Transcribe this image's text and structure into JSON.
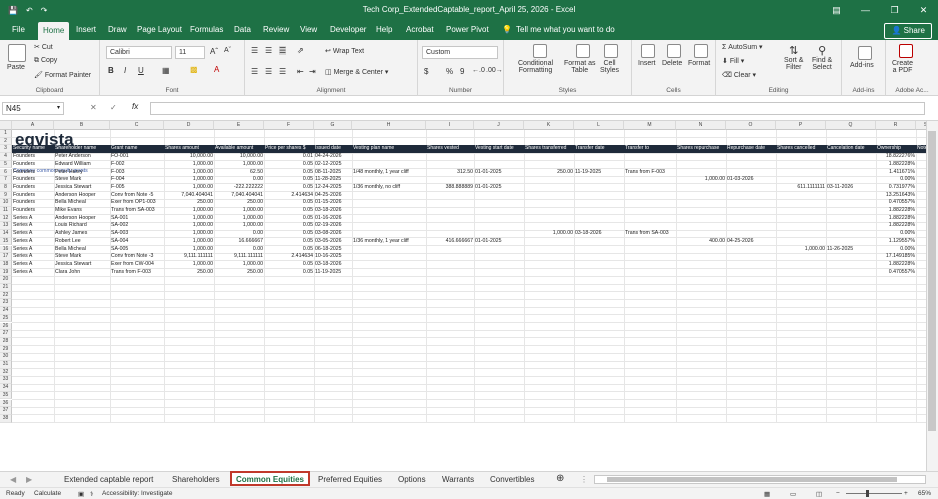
{
  "window": {
    "title": "Tech Corp_ExtendedCaptable_report_April 25, 2026  -  Excel",
    "minimize": "—",
    "restore": "❐",
    "close": "✕"
  },
  "ribbon_tabs": [
    "File",
    "Home",
    "Insert",
    "Draw",
    "Page Layout",
    "Formulas",
    "Data",
    "Review",
    "View",
    "Developer",
    "Help",
    "Acrobat",
    "Power Pivot"
  ],
  "active_tab": "Home",
  "tell_me": "Tell me what you want to do",
  "share": "Share",
  "ribbon": {
    "clipboard": {
      "paste": "Paste",
      "cut": "Cut",
      "copy": "Copy",
      "format_painter": "Format Painter",
      "label": "Clipboard"
    },
    "font": {
      "name": "Calibri",
      "size": "11",
      "bold": "B",
      "italic": "I",
      "underline": "U",
      "label": "Font"
    },
    "alignment": {
      "wrap": "Wrap Text",
      "merge": "Merge & Center",
      "label": "Alignment"
    },
    "number": {
      "format": "Custom",
      "dollar": "$",
      "percent": "%",
      "comma": "9",
      "label": "Number"
    },
    "styles": {
      "cond": "Conditional",
      "cond2": "Formatting",
      "fmt_table": "Format as",
      "fmt_table2": "Table",
      "cell_styles": "Cell",
      "cell_styles2": "Styles",
      "label": "Styles"
    },
    "cells": {
      "insert": "Insert",
      "delete": "Delete",
      "format": "Format",
      "label": "Cells"
    },
    "editing": {
      "autosum": "AutoSum",
      "fill": "Fill",
      "clear": "Clear",
      "sort": "Sort &",
      "sort2": "Filter",
      "find": "Find &",
      "find2": "Select",
      "label": "Editing"
    },
    "addins": {
      "addins": "Add-ins",
      "label": "Add-ins"
    },
    "adobe": {
      "create": "Create",
      "create2": "a PDF",
      "label": "Adobe Ac..."
    }
  },
  "formula_bar": {
    "name_box": "N45",
    "fx": "fx",
    "cancel": "✕",
    "enter": "✓",
    "value": ""
  },
  "columns": [
    "A",
    "B",
    "C",
    "D",
    "E",
    "F",
    "G",
    "H",
    "I",
    "J",
    "K",
    "L",
    "M",
    "N",
    "O",
    "P",
    "Q",
    "R",
    "S"
  ],
  "rows": [
    "1",
    "2",
    "3",
    "4",
    "5",
    "6",
    "7",
    "8",
    "9",
    "10",
    "11",
    "12",
    "13",
    "14",
    "15",
    "16",
    "17",
    "18",
    "19",
    "20",
    "21",
    "22",
    "23",
    "24",
    "25",
    "26",
    "27",
    "28",
    "29",
    "30",
    "31",
    "32",
    "33",
    "34",
    "35",
    "36",
    "37",
    "38"
  ],
  "sheet": {
    "logo": "eqvista",
    "subtitle": "Company common equity grants",
    "headers": [
      "Security name",
      "Shareholder name",
      "Grant name",
      "Shares amount",
      "Available amount",
      "Price per shares $",
      "Issued date",
      "Vesting plan name",
      "Shares vested",
      "Vesting start date",
      "Shares transferred",
      "Transfer date",
      "Transfer to",
      "Shares repurchase",
      "Repurchase date",
      "Shares cancelled",
      "Cancelation date",
      "Ownership",
      "Notes"
    ],
    "data": [
      [
        "Founders",
        "Peter Anderson",
        "FO-001",
        "10,000.00",
        "10,000.00",
        "0.01",
        "04-24-2026",
        "",
        "",
        "",
        "",
        "",
        "",
        "",
        "",
        "",
        "",
        "18.822276%",
        ""
      ],
      [
        "Founders",
        "Edward William",
        "F-002",
        "1,000.00",
        "1,000.00",
        "0.05",
        "02-12-2025",
        "",
        "",
        "",
        "",
        "",
        "",
        "",
        "",
        "",
        "",
        "1.882228%",
        ""
      ],
      [
        "Founders",
        "Peter Henry",
        "F-003",
        "1,000.00",
        "62.50",
        "0.05",
        "08-11-2025",
        "1/48 monthly, 1 year cliff",
        "312.50",
        "01-01-2025",
        "250.00",
        "11-19-2025",
        "Trans from F-003",
        "",
        "",
        "",
        "",
        "1.411671%",
        ""
      ],
      [
        "Founders",
        "Steve Mark",
        "F-004",
        "1,000.00",
        "0.00",
        "0.05",
        "11-28-2025",
        "",
        "",
        "",
        "",
        "",
        "",
        "1,000.00",
        "01-03-2026",
        "",
        "",
        "0.00%",
        ""
      ],
      [
        "Founders",
        "Jessica Stewart",
        "F-005",
        "1,000.00",
        "-222.222222",
        "0.05",
        "12-24-2025",
        "1/36 monthly, no cliff",
        "388.888889",
        "01-01-2025",
        "",
        "",
        "",
        "",
        "",
        "611.1111111",
        "03-11-2026",
        "0.731977%",
        ""
      ],
      [
        "Founders",
        "Anderson Hooper",
        "Conv from Note -5",
        "7,040.404041",
        "7,040.404041",
        "2.414634",
        "04-25-2026",
        "",
        "",
        "",
        "",
        "",
        "",
        "",
        "",
        "",
        "",
        "13.251643%",
        ""
      ],
      [
        "Founders",
        "Bella Micheal",
        "Exer from OP1-003",
        "250.00",
        "250.00",
        "0.05",
        "01-15-2026",
        "",
        "",
        "",
        "",
        "",
        "",
        "",
        "",
        "",
        "",
        "0.470557%",
        ""
      ],
      [
        "Founders",
        "Mike Evans",
        "Trans from SA-003",
        "1,000.00",
        "1,000.00",
        "0.05",
        "03-18-2026",
        "",
        "",
        "",
        "",
        "",
        "",
        "",
        "",
        "",
        "",
        "1.882228%",
        ""
      ],
      [
        "Series A",
        "Anderson Hooper",
        "SA-001",
        "1,000.00",
        "1,000.00",
        "0.05",
        "01-16-2026",
        "",
        "",
        "",
        "",
        "",
        "",
        "",
        "",
        "",
        "",
        "1.882228%",
        ""
      ],
      [
        "Series A",
        "Louis Richard",
        "SA-002",
        "1,000.00",
        "1,000.00",
        "0.05",
        "02-19-2026",
        "",
        "",
        "",
        "",
        "",
        "",
        "",
        "",
        "",
        "",
        "1.882228%",
        ""
      ],
      [
        "Series A",
        "Ashley James",
        "SA-003",
        "1,000.00",
        "0.00",
        "0.05",
        "03-08-2026",
        "",
        "",
        "",
        "1,000.00",
        "03-18-2026",
        "Trans from SA-003",
        "",
        "",
        "",
        "",
        "0.00%",
        ""
      ],
      [
        "Series A",
        "Robert Lee",
        "SA-004",
        "1,000.00",
        "16.666667",
        "0.05",
        "03-05-2026",
        "1/36 monthly, 1 year cliff",
        "416.666667",
        "01-01-2025",
        "",
        "",
        "",
        "400.00",
        "04-25-2026",
        "",
        "",
        "1.129557%",
        ""
      ],
      [
        "Series A",
        "Bella Micheal",
        "SA-005",
        "1,000.00",
        "0.00",
        "0.05",
        "06-18-2025",
        "",
        "",
        "",
        "",
        "",
        "",
        "",
        "",
        "1,000.00",
        "11-26-2025",
        "0.00%",
        ""
      ],
      [
        "Series A",
        "Steve Mark",
        "Conv from Note -3",
        "9,111.111111",
        "9,111.111111",
        "2.414634",
        "10-16-2025",
        "",
        "",
        "",
        "",
        "",
        "",
        "",
        "",
        "",
        "",
        "17.149185%",
        ""
      ],
      [
        "Series A",
        "Jessica Stewart",
        "Exer from CW-004",
        "1,000.00",
        "1,000.00",
        "0.05",
        "03-18-2026",
        "",
        "",
        "",
        "",
        "",
        "",
        "",
        "",
        "",
        "",
        "1.882228%",
        ""
      ],
      [
        "Series A",
        "Clara John",
        "Trans from F-003",
        "250.00",
        "250.00",
        "0.05",
        "11-19-2025",
        "",
        "",
        "",
        "",
        "",
        "",
        "",
        "",
        "",
        "",
        "0.470557%",
        ""
      ]
    ]
  },
  "sheet_tabs": [
    "Extended captable report",
    "Shareholders",
    "Common Equities",
    "Preferred Equities",
    "Options",
    "Warrants",
    "Convertibles"
  ],
  "active_sheet": "Common Equities",
  "status": {
    "ready": "Ready",
    "calculate": "Calculate",
    "accessibility": "Accessibility: Investigate",
    "zoom": "65%"
  }
}
